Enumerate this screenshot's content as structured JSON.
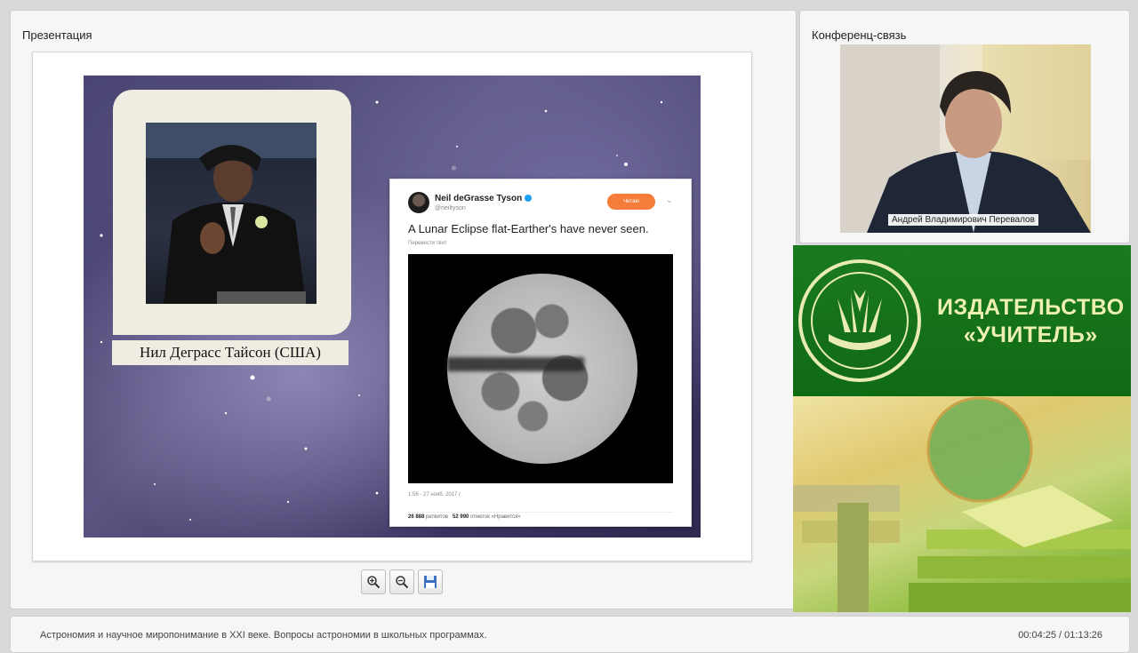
{
  "presentation": {
    "panel_title": "Презентация",
    "slide": {
      "caption": "Нил Деграсс Тайсон (США)",
      "tweet": {
        "name": "Neil deGrasse Tyson",
        "handle": "@neiltyson",
        "follow_label": "Читаю",
        "text": "A Lunar Eclipse flat-Earther's have never seen.",
        "translate": "Перевести твит",
        "timestamp": "1:56 - 27 нояб. 2017 г.",
        "retweets": "26 888",
        "retweets_label": "ретвитов",
        "likes": "52 990",
        "likes_label": "отметок «Нравится»"
      }
    },
    "toolbar": {
      "zoom_in_icon": "zoom-in-icon",
      "zoom_out_icon": "zoom-out-icon",
      "save_icon": "save-icon"
    }
  },
  "conference": {
    "panel_title": "Конференц-связь",
    "speaker_name": "Андрей Владимирович Перевалов"
  },
  "banner": {
    "line1": "ИЗДАТЕЛЬСТВО",
    "line2": "«УЧИТЕЛЬ»"
  },
  "footer": {
    "title": "Астрономия и научное миропонимание в XXI веке. Вопросы астрономии в школьных программах.",
    "time": "00:04:25 / 01:13:26"
  },
  "colors": {
    "banner_green": "#0f6a14",
    "follow_orange": "#f57c3a",
    "verified_blue": "#1da1f2"
  }
}
